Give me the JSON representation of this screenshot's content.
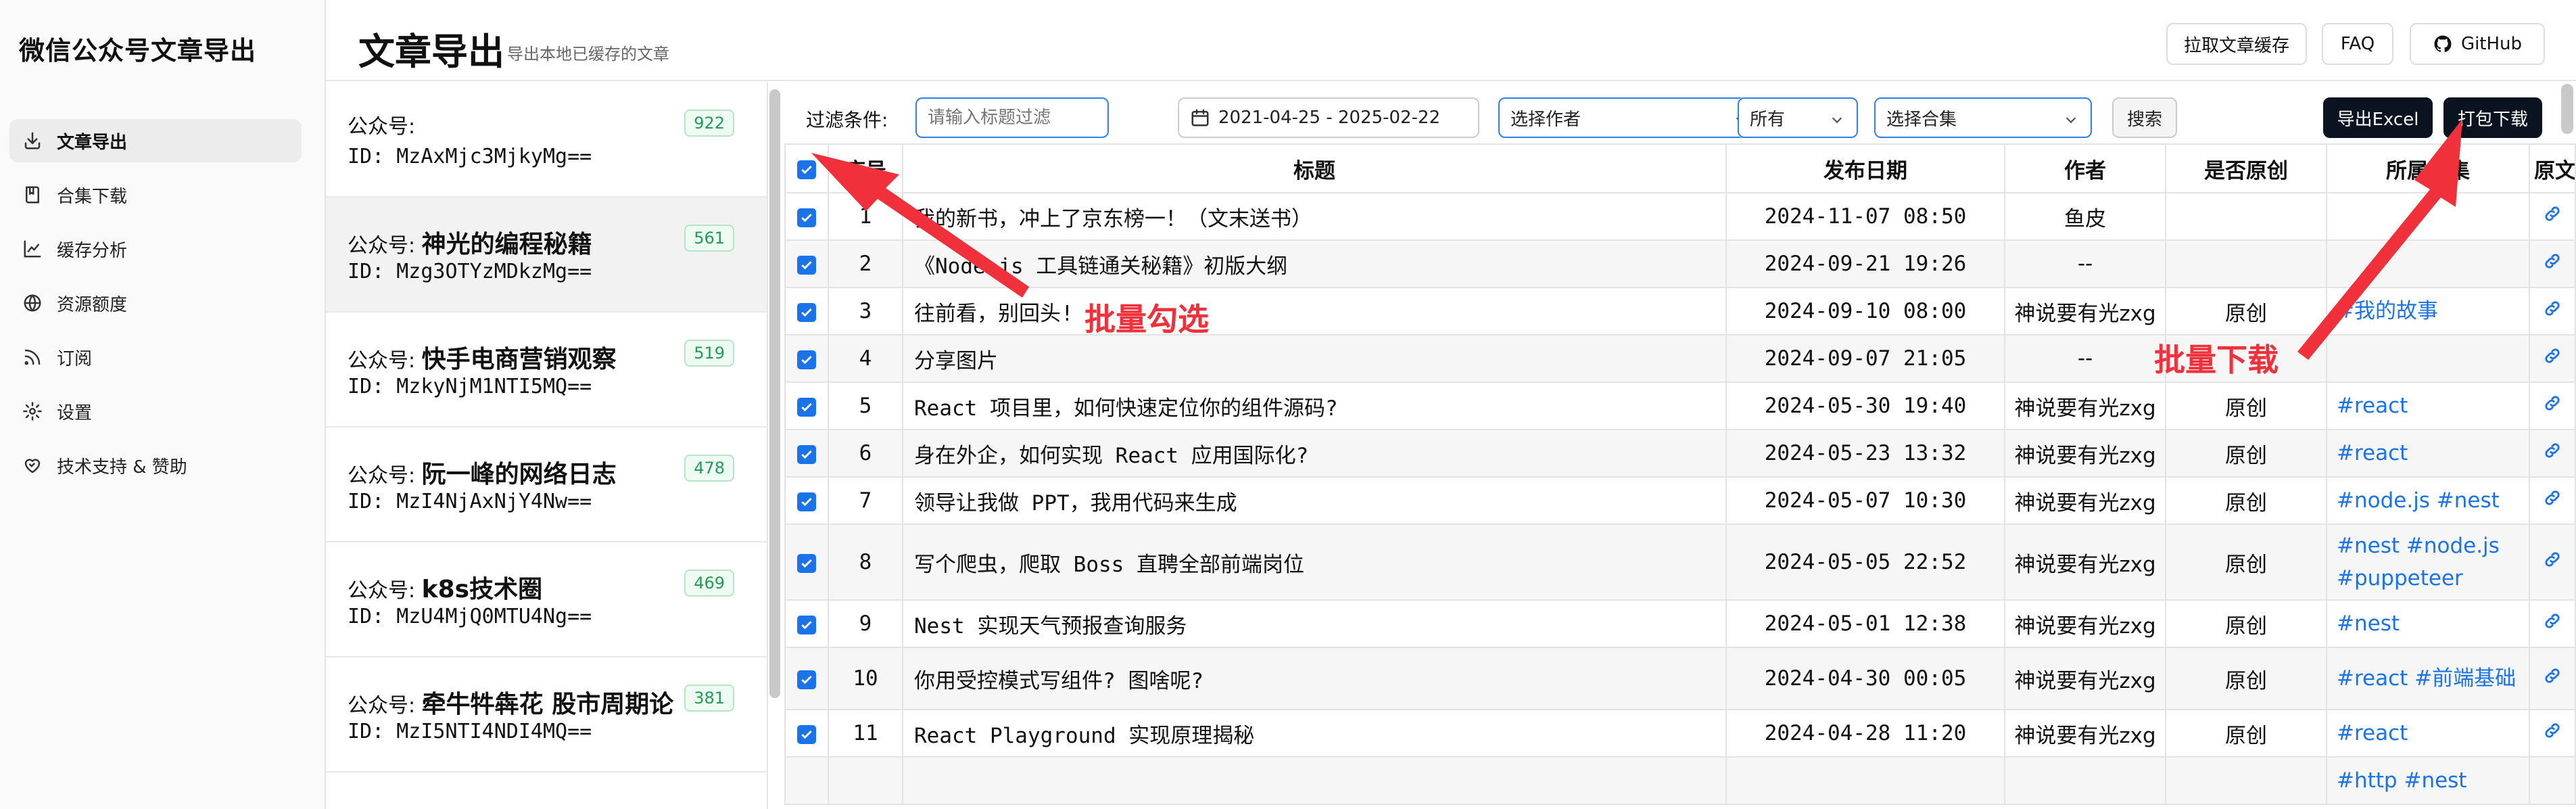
{
  "app": {
    "title": "微信公众号文章导出"
  },
  "sidebar": {
    "items": [
      {
        "label": "文章导出",
        "icon": "download-icon",
        "active": true
      },
      {
        "label": "合集下载",
        "icon": "book-icon"
      },
      {
        "label": "缓存分析",
        "icon": "chart-icon"
      },
      {
        "label": "资源额度",
        "icon": "globe-icon"
      },
      {
        "label": "订阅",
        "icon": "rss-icon"
      },
      {
        "label": "设置",
        "icon": "gear-icon"
      },
      {
        "label": "技术支持 & 赞助",
        "icon": "heart-handshake-icon"
      }
    ]
  },
  "header": {
    "title": "文章导出",
    "subtitle": "导出本地已缓存的文章",
    "buttons": {
      "cache": "拉取文章缓存",
      "faq": "FAQ",
      "github": "GitHub"
    }
  },
  "accounts": [
    {
      "prefix": "公众号:",
      "name": "",
      "id": "ID: MzAxMjc3MjkyMg==",
      "count": "922"
    },
    {
      "prefix": "公众号:",
      "name": "神光的编程秘籍",
      "id": "ID: Mzg3OTYzMDkzMg==",
      "count": "561"
    },
    {
      "prefix": "公众号:",
      "name": "快手电商营销观察",
      "id": "ID: MzkyNjM1NTI5MQ==",
      "count": "519"
    },
    {
      "prefix": "公众号:",
      "name": "阮一峰的网络日志",
      "id": "ID: MzI4NjAxNjY4Nw==",
      "count": "478"
    },
    {
      "prefix": "公众号:",
      "name": "k8s技术圈",
      "id": "ID: MzU4MjQ0MTU4Ng==",
      "count": "469"
    },
    {
      "prefix": "公众号:",
      "name": "牵牛牪犇花 股市周期论",
      "id": "ID: MzI5NTI4NDI4MQ==",
      "count": "381"
    }
  ],
  "filters": {
    "label": "过滤条件:",
    "title_placeholder": "请输入标题过滤",
    "date_range": "2021-04-25 - 2025-02-22",
    "author_placeholder": "选择作者",
    "original": "所有",
    "collection_placeholder": "选择合集",
    "search": "搜索",
    "export_excel": "导出Excel",
    "pack_download": "打包下载"
  },
  "table": {
    "headers": [
      "序号",
      "标题",
      "发布日期",
      "作者",
      "是否原创",
      "所属合集",
      "原文"
    ],
    "rows": [
      {
        "no": "1",
        "title": "我的新书，冲上了京东榜一！（文末送书）",
        "date": "2024-11-07 08:50",
        "author": "鱼皮",
        "original": "",
        "collection": ""
      },
      {
        "no": "2",
        "title": "《Node.js 工具链通关秘籍》初版大纲",
        "date": "2024-09-21 19:26",
        "author": "--",
        "original": "",
        "collection": ""
      },
      {
        "no": "3",
        "title": "往前看，别回头!",
        "date": "2024-09-10 08:00",
        "author": "神说要有光zxg",
        "original": "原创",
        "collection": "#我的故事"
      },
      {
        "no": "4",
        "title": "分享图片",
        "date": "2024-09-07 21:05",
        "author": "--",
        "original": "",
        "collection": ""
      },
      {
        "no": "5",
        "title": "React 项目里，如何快速定位你的组件源码?",
        "date": "2024-05-30 19:40",
        "author": "神说要有光zxg",
        "original": "原创",
        "collection": "#react"
      },
      {
        "no": "6",
        "title": "身在外企，如何实现 React 应用国际化?",
        "date": "2024-05-23 13:32",
        "author": "神说要有光zxg",
        "original": "原创",
        "collection": "#react"
      },
      {
        "no": "7",
        "title": "领导让我做 PPT，我用代码来生成",
        "date": "2024-05-07 10:30",
        "author": "神说要有光zxg",
        "original": "原创",
        "collection": "#node.js #nest"
      },
      {
        "no": "8",
        "title": "写个爬虫，爬取 Boss 直聘全部前端岗位",
        "date": "2024-05-05 22:52",
        "author": "神说要有光zxg",
        "original": "原创",
        "collection": "#nest #node.js #puppeteer"
      },
      {
        "no": "9",
        "title": "Nest 实现天气预报查询服务",
        "date": "2024-05-01 12:38",
        "author": "神说要有光zxg",
        "original": "原创",
        "collection": "#nest"
      },
      {
        "no": "10",
        "title": "你用受控模式写组件? 图啥呢?",
        "date": "2024-04-30 00:05",
        "author": "神说要有光zxg",
        "original": "原创",
        "collection": "#react #前端基础"
      },
      {
        "no": "11",
        "title": "React Playground 实现原理揭秘",
        "date": "2024-04-28 11:20",
        "author": "神说要有光zxg",
        "original": "原创",
        "collection": "#react"
      },
      {
        "no": "",
        "title": "",
        "date": "",
        "author": "",
        "original": "",
        "collection": "#http #nest"
      }
    ]
  },
  "annotations": {
    "batch_select": "批量勾选",
    "batch_download": "批量下载"
  },
  "colors": {
    "accent": "#1a73e8",
    "annotation": "#f0303a",
    "badge_green": "#1f9d55",
    "dark_button": "#0b1220"
  }
}
